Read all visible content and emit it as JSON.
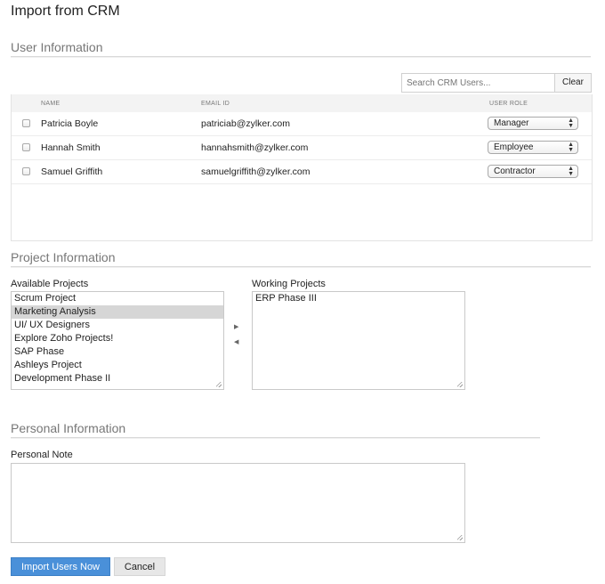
{
  "page_title": "Import from CRM",
  "user_section": {
    "title": "User Information",
    "search_placeholder": "Search CRM Users...",
    "clear_label": "Clear",
    "columns": {
      "name": "NAME",
      "email": "EMAIL ID",
      "role": "USER ROLE"
    },
    "users": [
      {
        "name": "Patricia Boyle",
        "email": "patriciab@zylker.com",
        "role": "Manager"
      },
      {
        "name": "Hannah Smith",
        "email": "hannahsmith@zylker.com",
        "role": "Employee"
      },
      {
        "name": "Samuel Griffith",
        "email": "samuelgriffith@zylker.com",
        "role": "Contractor"
      }
    ]
  },
  "project_section": {
    "title": "Project Information",
    "available_label": "Available Projects",
    "working_label": "Working Projects",
    "available": [
      "Scrum Project",
      "Marketing Analysis",
      "UI/ UX Designers",
      "Explore Zoho Projects!",
      "SAP Phase",
      "Ashleys Project",
      "Development Phase II"
    ],
    "selected_available": "Marketing Analysis",
    "working": [
      "ERP Phase III"
    ]
  },
  "personal_section": {
    "title": "Personal Information",
    "note_label": "Personal Note",
    "note_value": ""
  },
  "actions": {
    "import_label": "Import Users Now",
    "cancel_label": "Cancel"
  },
  "colors": {
    "primary": "#4a90d9",
    "selected_row": "#d6d6d6",
    "header_bg": "#f3f3f3"
  }
}
